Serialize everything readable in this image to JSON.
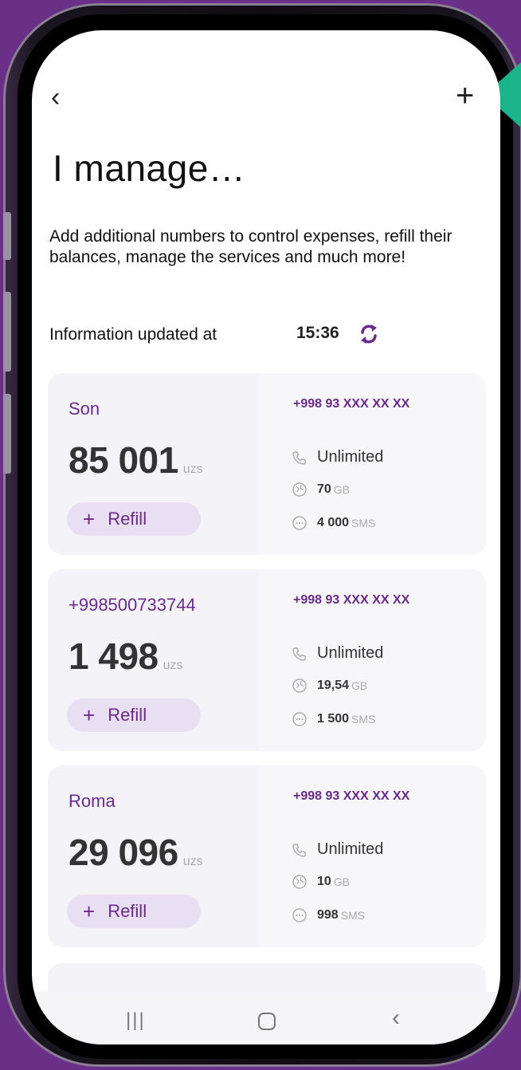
{
  "header": {
    "back_icon": "chevron-left-icon",
    "back_label": "‹",
    "add_icon": "plus-icon",
    "add_label": "+",
    "title": "I manage…"
  },
  "description": "Add additional numbers to control expenses, refill their balances, manage the services and much more!",
  "update": {
    "label": "Information updated at",
    "time": "15:36",
    "icon": "refresh-icon"
  },
  "colors": {
    "accent": "#6a2a8c",
    "background": "#6a2f86",
    "card": "#f4f4f8",
    "refill_bg": "#e8dff2",
    "highlight": "#1bb38a"
  },
  "cards": [
    {
      "name": "Son",
      "balance": "85 001",
      "unit": "uzs",
      "refill_label": "Refill",
      "phone": "+998 93 XXX XX XX",
      "calls": "Unlimited",
      "data_value": "70",
      "data_unit": "GB",
      "sms_value": "4 000",
      "sms_unit": "SMS"
    },
    {
      "name": "+998500733744",
      "balance": "1 498",
      "unit": "uzs",
      "refill_label": "Refill",
      "phone": "+998 93 XXX XX XX",
      "calls": "Unlimited",
      "data_value": "19,54",
      "data_unit": "GB",
      "sms_value": "1 500",
      "sms_unit": "SMS"
    },
    {
      "name": "Roma",
      "balance": "29 096",
      "unit": "uzs",
      "refill_label": "Refill",
      "phone": "+998 93 XXX XX XX",
      "calls": "Unlimited",
      "data_value": "10",
      "data_unit": "GB",
      "sms_value": "998",
      "sms_unit": "SMS"
    }
  ],
  "nav": {
    "recent_label": "|||",
    "back_label": "‹"
  }
}
